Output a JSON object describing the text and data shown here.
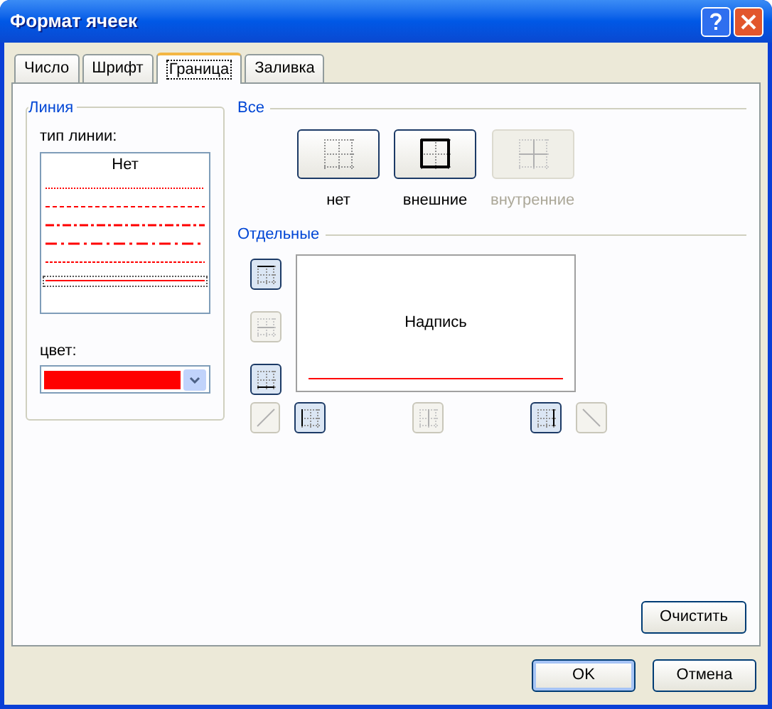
{
  "window": {
    "title": "Формат ячеек"
  },
  "tabs": [
    {
      "label": "Число",
      "selected": false
    },
    {
      "label": "Шрифт",
      "selected": false
    },
    {
      "label": "Граница",
      "selected": true
    },
    {
      "label": "Заливка",
      "selected": false
    }
  ],
  "line_group": {
    "title": "Линия",
    "style_label": "тип линии:",
    "styles": [
      {
        "kind": "none",
        "label": "Нет",
        "selected": false
      },
      {
        "kind": "dotted",
        "selected": false
      },
      {
        "kind": "dashed",
        "selected": false
      },
      {
        "kind": "dashdot",
        "selected": false
      },
      {
        "kind": "longdash",
        "selected": false
      },
      {
        "kind": "fine",
        "selected": false
      },
      {
        "kind": "solid",
        "selected": true
      }
    ],
    "color_label": "цвет:",
    "color": "#ff0000"
  },
  "presets": {
    "title": "Все",
    "items": [
      {
        "kind": "none",
        "label": "нет",
        "disabled": false
      },
      {
        "kind": "outline",
        "label": "внешние",
        "disabled": false
      },
      {
        "kind": "inside",
        "label": "внутренние",
        "disabled": true
      }
    ]
  },
  "borders": {
    "title": "Отдельные",
    "preview_text": "Надпись",
    "side_buttons": [
      {
        "kind": "top",
        "pressed": true,
        "disabled": false
      },
      {
        "kind": "hinner",
        "disabled": true
      },
      {
        "kind": "bottom",
        "pressed": true,
        "disabled": false
      }
    ],
    "bottom_buttons": [
      {
        "kind": "diagup",
        "disabled": true
      },
      {
        "kind": "left",
        "pressed": true,
        "disabled": false
      },
      {
        "kind": "vinner",
        "disabled": true
      },
      {
        "kind": "right",
        "pressed": true,
        "disabled": false
      },
      {
        "kind": "diagdown",
        "disabled": true
      }
    ]
  },
  "clear_button": "Очистить",
  "buttons": [
    {
      "label": "OK",
      "default": true
    },
    {
      "label": "Отмена",
      "default": false
    }
  ]
}
